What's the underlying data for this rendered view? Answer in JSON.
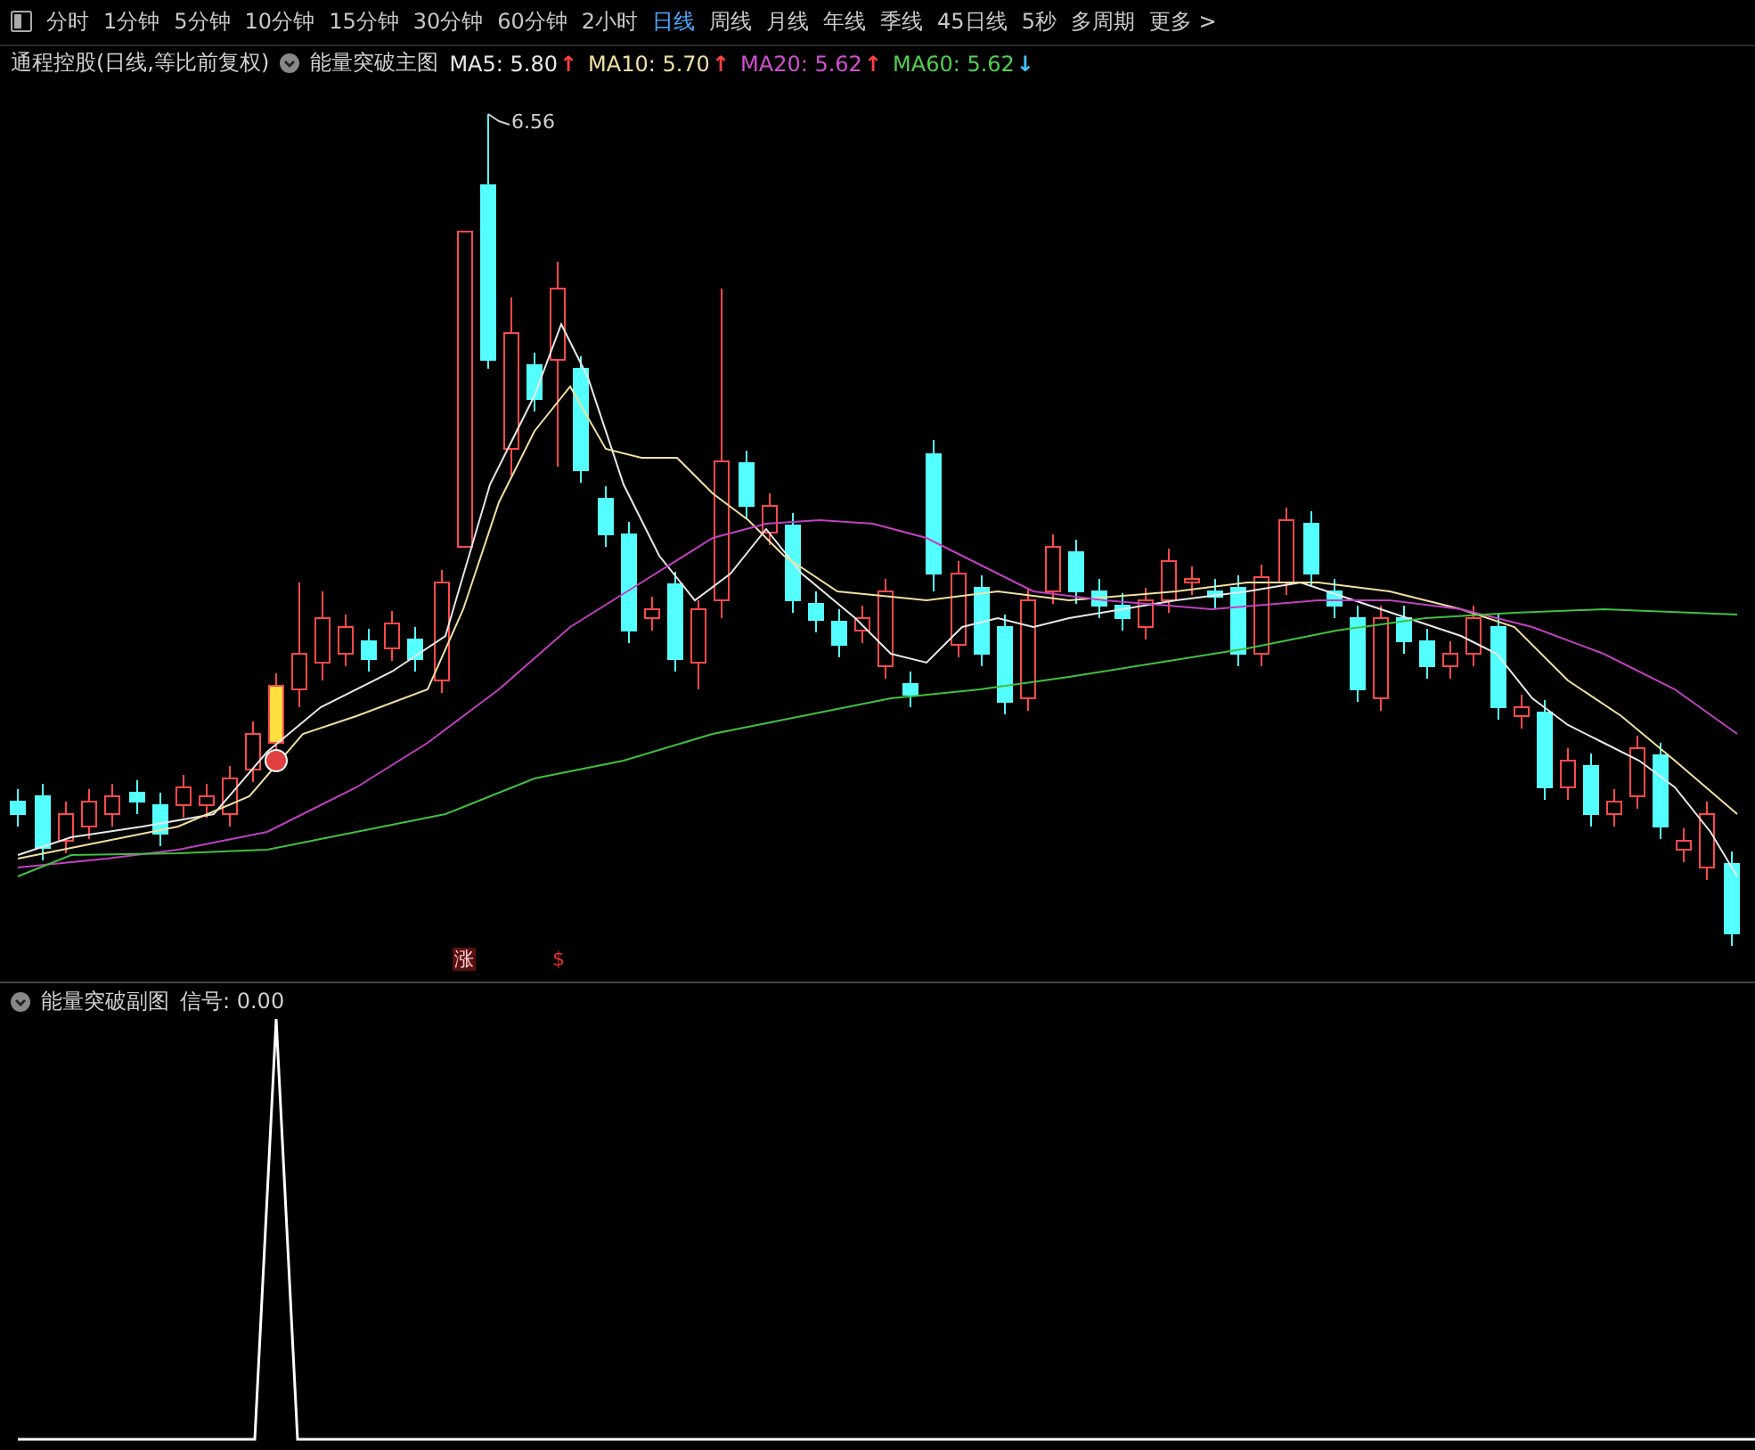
{
  "toolbar": {
    "tabs": [
      {
        "label": "分时",
        "selected": false
      },
      {
        "label": "1分钟",
        "selected": false
      },
      {
        "label": "5分钟",
        "selected": false
      },
      {
        "label": "10分钟",
        "selected": false
      },
      {
        "label": "15分钟",
        "selected": false
      },
      {
        "label": "30分钟",
        "selected": false
      },
      {
        "label": "60分钟",
        "selected": false
      },
      {
        "label": "2小时",
        "selected": false
      },
      {
        "label": "日线",
        "selected": true
      },
      {
        "label": "周线",
        "selected": false
      },
      {
        "label": "月线",
        "selected": false
      },
      {
        "label": "年线",
        "selected": false
      },
      {
        "label": "季线",
        "selected": false
      },
      {
        "label": "45日线",
        "selected": false
      },
      {
        "label": "5秒",
        "selected": false
      },
      {
        "label": "多周期",
        "selected": false
      },
      {
        "label": "更多 >",
        "selected": false
      }
    ]
  },
  "legend": {
    "stock": "通程控股(日线,等比前复权)",
    "indicator": "能量突破主图",
    "averages": [
      {
        "label": "MA5: 5.80",
        "arrow": "↑",
        "rising": true,
        "color": "#e8e8e8"
      },
      {
        "label": "MA10: 5.70",
        "arrow": "↑",
        "rising": true,
        "color": "#f0e0a0"
      },
      {
        "label": "MA20: 5.62",
        "arrow": "↑",
        "rising": true,
        "color": "#d050d0"
      },
      {
        "label": "MA60: 5.62",
        "arrow": "↓",
        "rising": false,
        "color": "#50d050"
      }
    ]
  },
  "main_chart": {
    "high_label": "6.56",
    "signals": [
      {
        "kind": "rise",
        "text": "涨"
      },
      {
        "kind": "dollar",
        "text": "$"
      }
    ]
  },
  "sub_chart": {
    "indicator": "能量突破副图",
    "reading": "信号: 0.00"
  }
}
